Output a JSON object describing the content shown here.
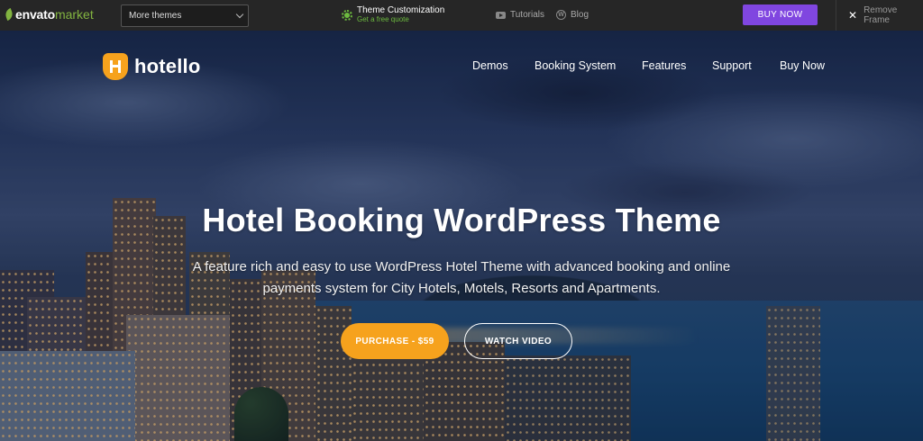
{
  "envato": {
    "logo_word1": "envato",
    "logo_word2": "market",
    "themes_select": "More themes",
    "customization_title": "Theme Customization",
    "customization_sub": "Get a free quote",
    "tutorials": "Tutorials",
    "blog": "Blog",
    "buy_now": "BUY NOW",
    "remove_frame": "Remove Frame"
  },
  "site": {
    "brand": "hotello",
    "nav": [
      "Demos",
      "Booking System",
      "Features",
      "Support",
      "Buy Now"
    ]
  },
  "hero": {
    "headline": "Hotel Booking WordPress Theme",
    "subline_1": "A feature rich and easy to use WordPress Hotel Theme with advanced booking and online",
    "subline_2": "payments system for City Hotels, Motels, Resorts and Apartments.",
    "purchase": "PURCHASE - $59",
    "watch_video": "WATCH VIDEO"
  },
  "colors": {
    "envato_green": "#82b440",
    "buy_now_purple": "#8046e0",
    "accent_orange": "#f6a21d"
  }
}
